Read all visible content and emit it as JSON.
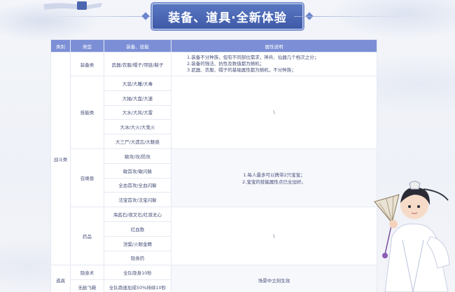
{
  "header": {
    "title": "装备、道具·全新体验"
  },
  "table": {
    "headers": [
      "类别",
      "类型",
      "装备、技能",
      "属性说明"
    ],
    "battle": {
      "category": "战斗类",
      "equipment": {
        "type": "装备类",
        "item": "武器/衣服/帽子/项链/鞋子",
        "desc_lines": [
          "1.装备不分种族，但有不同部位需求，神兵、仙器几个档次之分；",
          "2.装备的强法、抗性及数值都为随机；",
          "3.武器、衣服、帽子的基础属性都为随机，不分种族；"
        ]
      },
      "skills": {
        "type": "技能类",
        "items": [
          "大混/大睡/大毒",
          "大抽/大盘/大速",
          "大水/大风/大雷",
          "大冰/大火/大鬼火",
          "大三尸/大遗忘/大魅惑"
        ],
        "desc": "\\"
      },
      "bao": {
        "type": "召唤兽",
        "items": [
          "敏攻/攻/防攻",
          "敏首攻/敏闪躲",
          "全血首攻/全血闪躲",
          "法宝首攻/法宝闪躲"
        ],
        "desc_lines": [
          "1.每人最多可以携带2只宝宝；",
          "2.宝宝的技能属性点已全加好。"
        ]
      },
      "medicine": {
        "type": "药品",
        "items": [
          "海蓝石/夜叉石/红孩无心",
          "红血散",
          "涅槃/火眼金睛",
          "隐身药"
        ],
        "desc": "\\"
      }
    },
    "props": {
      "category": "道具",
      "rows": [
        {
          "type": "隐身术",
          "item": "全队隐身10秒"
        },
        {
          "type": "无敌飞鞋",
          "item": "全队跑速加成50%持续10秒"
        }
      ],
      "desc": "场景中立刻生效"
    }
  }
}
